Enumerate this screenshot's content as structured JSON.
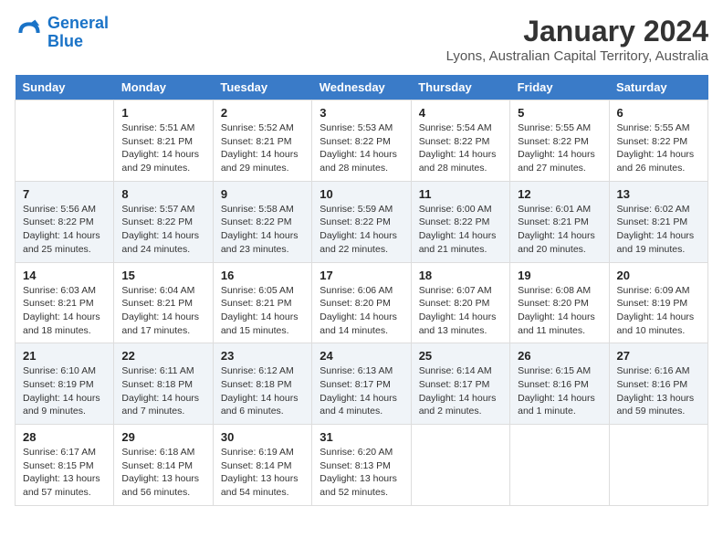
{
  "logo": {
    "line1": "General",
    "line2": "Blue"
  },
  "title": "January 2024",
  "subtitle": "Lyons, Australian Capital Territory, Australia",
  "weekdays": [
    "Sunday",
    "Monday",
    "Tuesday",
    "Wednesday",
    "Thursday",
    "Friday",
    "Saturday"
  ],
  "weeks": [
    [
      {
        "day": "",
        "info": ""
      },
      {
        "day": "1",
        "info": "Sunrise: 5:51 AM\nSunset: 8:21 PM\nDaylight: 14 hours\nand 29 minutes."
      },
      {
        "day": "2",
        "info": "Sunrise: 5:52 AM\nSunset: 8:21 PM\nDaylight: 14 hours\nand 29 minutes."
      },
      {
        "day": "3",
        "info": "Sunrise: 5:53 AM\nSunset: 8:22 PM\nDaylight: 14 hours\nand 28 minutes."
      },
      {
        "day": "4",
        "info": "Sunrise: 5:54 AM\nSunset: 8:22 PM\nDaylight: 14 hours\nand 28 minutes."
      },
      {
        "day": "5",
        "info": "Sunrise: 5:55 AM\nSunset: 8:22 PM\nDaylight: 14 hours\nand 27 minutes."
      },
      {
        "day": "6",
        "info": "Sunrise: 5:55 AM\nSunset: 8:22 PM\nDaylight: 14 hours\nand 26 minutes."
      }
    ],
    [
      {
        "day": "7",
        "info": "Sunrise: 5:56 AM\nSunset: 8:22 PM\nDaylight: 14 hours\nand 25 minutes."
      },
      {
        "day": "8",
        "info": "Sunrise: 5:57 AM\nSunset: 8:22 PM\nDaylight: 14 hours\nand 24 minutes."
      },
      {
        "day": "9",
        "info": "Sunrise: 5:58 AM\nSunset: 8:22 PM\nDaylight: 14 hours\nand 23 minutes."
      },
      {
        "day": "10",
        "info": "Sunrise: 5:59 AM\nSunset: 8:22 PM\nDaylight: 14 hours\nand 22 minutes."
      },
      {
        "day": "11",
        "info": "Sunrise: 6:00 AM\nSunset: 8:22 PM\nDaylight: 14 hours\nand 21 minutes."
      },
      {
        "day": "12",
        "info": "Sunrise: 6:01 AM\nSunset: 8:21 PM\nDaylight: 14 hours\nand 20 minutes."
      },
      {
        "day": "13",
        "info": "Sunrise: 6:02 AM\nSunset: 8:21 PM\nDaylight: 14 hours\nand 19 minutes."
      }
    ],
    [
      {
        "day": "14",
        "info": "Sunrise: 6:03 AM\nSunset: 8:21 PM\nDaylight: 14 hours\nand 18 minutes."
      },
      {
        "day": "15",
        "info": "Sunrise: 6:04 AM\nSunset: 8:21 PM\nDaylight: 14 hours\nand 17 minutes."
      },
      {
        "day": "16",
        "info": "Sunrise: 6:05 AM\nSunset: 8:21 PM\nDaylight: 14 hours\nand 15 minutes."
      },
      {
        "day": "17",
        "info": "Sunrise: 6:06 AM\nSunset: 8:20 PM\nDaylight: 14 hours\nand 14 minutes."
      },
      {
        "day": "18",
        "info": "Sunrise: 6:07 AM\nSunset: 8:20 PM\nDaylight: 14 hours\nand 13 minutes."
      },
      {
        "day": "19",
        "info": "Sunrise: 6:08 AM\nSunset: 8:20 PM\nDaylight: 14 hours\nand 11 minutes."
      },
      {
        "day": "20",
        "info": "Sunrise: 6:09 AM\nSunset: 8:19 PM\nDaylight: 14 hours\nand 10 minutes."
      }
    ],
    [
      {
        "day": "21",
        "info": "Sunrise: 6:10 AM\nSunset: 8:19 PM\nDaylight: 14 hours\nand 9 minutes."
      },
      {
        "day": "22",
        "info": "Sunrise: 6:11 AM\nSunset: 8:18 PM\nDaylight: 14 hours\nand 7 minutes."
      },
      {
        "day": "23",
        "info": "Sunrise: 6:12 AM\nSunset: 8:18 PM\nDaylight: 14 hours\nand 6 minutes."
      },
      {
        "day": "24",
        "info": "Sunrise: 6:13 AM\nSunset: 8:17 PM\nDaylight: 14 hours\nand 4 minutes."
      },
      {
        "day": "25",
        "info": "Sunrise: 6:14 AM\nSunset: 8:17 PM\nDaylight: 14 hours\nand 2 minutes."
      },
      {
        "day": "26",
        "info": "Sunrise: 6:15 AM\nSunset: 8:16 PM\nDaylight: 14 hours\nand 1 minute."
      },
      {
        "day": "27",
        "info": "Sunrise: 6:16 AM\nSunset: 8:16 PM\nDaylight: 13 hours\nand 59 minutes."
      }
    ],
    [
      {
        "day": "28",
        "info": "Sunrise: 6:17 AM\nSunset: 8:15 PM\nDaylight: 13 hours\nand 57 minutes."
      },
      {
        "day": "29",
        "info": "Sunrise: 6:18 AM\nSunset: 8:14 PM\nDaylight: 13 hours\nand 56 minutes."
      },
      {
        "day": "30",
        "info": "Sunrise: 6:19 AM\nSunset: 8:14 PM\nDaylight: 13 hours\nand 54 minutes."
      },
      {
        "day": "31",
        "info": "Sunrise: 6:20 AM\nSunset: 8:13 PM\nDaylight: 13 hours\nand 52 minutes."
      },
      {
        "day": "",
        "info": ""
      },
      {
        "day": "",
        "info": ""
      },
      {
        "day": "",
        "info": ""
      }
    ]
  ]
}
